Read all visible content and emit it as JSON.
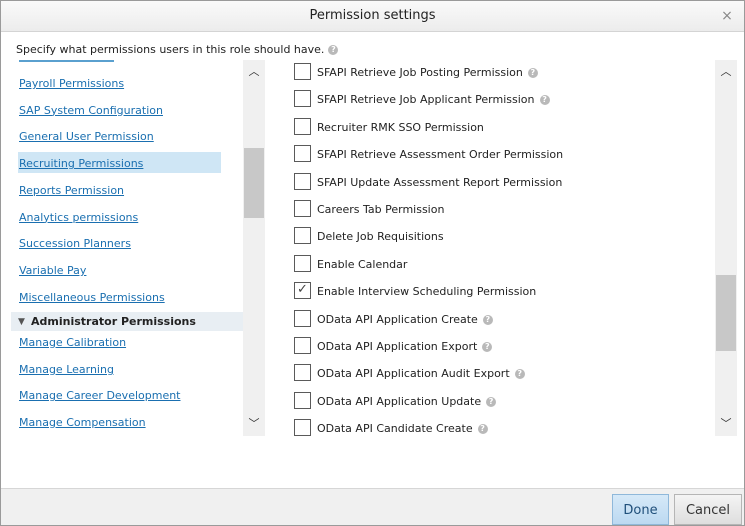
{
  "dialog": {
    "title": "Permission settings",
    "close_glyph": "×",
    "instructions": "Specify what permissions users in this role should have.",
    "help_glyph": "?"
  },
  "left_nav": {
    "items": [
      {
        "label": "Payroll Permissions"
      },
      {
        "label": "SAP System Configuration"
      },
      {
        "label": "General User Permission"
      },
      {
        "label": "Recruiting Permissions",
        "selected": true
      },
      {
        "label": "Reports Permission"
      },
      {
        "label": "Analytics permissions"
      },
      {
        "label": "Succession Planners"
      },
      {
        "label": "Variable Pay"
      },
      {
        "label": "Miscellaneous Permissions"
      }
    ],
    "section_header": "Administrator Permissions",
    "section_caret": "▼",
    "admin_items": [
      {
        "label": "Manage Calibration"
      },
      {
        "label": "Manage Learning"
      },
      {
        "label": "Manage Career Development"
      },
      {
        "label": "Manage Compensation"
      }
    ]
  },
  "permissions": [
    {
      "label": "SFAPI Retrieve Job Posting Permission",
      "checked": false,
      "help": true
    },
    {
      "label": "SFAPI Retrieve Job Applicant Permission",
      "checked": false,
      "help": true
    },
    {
      "label": "Recruiter RMK SSO Permission",
      "checked": false,
      "help": false
    },
    {
      "label": "SFAPI Retrieve Assessment Order Permission",
      "checked": false,
      "help": false
    },
    {
      "label": "SFAPI Update Assessment Report Permission",
      "checked": false,
      "help": false
    },
    {
      "label": "Careers Tab Permission",
      "checked": false,
      "help": false
    },
    {
      "label": "Delete Job Requisitions",
      "checked": false,
      "help": false
    },
    {
      "label": "Enable Calendar",
      "checked": false,
      "help": false
    },
    {
      "label": "Enable Interview Scheduling Permission",
      "checked": true,
      "help": false
    },
    {
      "label": "OData API Application Create",
      "checked": false,
      "help": true
    },
    {
      "label": "OData API Application Export",
      "checked": false,
      "help": true
    },
    {
      "label": "OData API Application Audit Export",
      "checked": false,
      "help": true
    },
    {
      "label": "OData API Application Update",
      "checked": false,
      "help": true
    },
    {
      "label": "OData API Candidate Create",
      "checked": false,
      "help": true
    }
  ],
  "scroll": {
    "up_glyph": "︿",
    "down_glyph": "﹀"
  },
  "footer": {
    "done_label": "Done",
    "cancel_label": "Cancel"
  }
}
